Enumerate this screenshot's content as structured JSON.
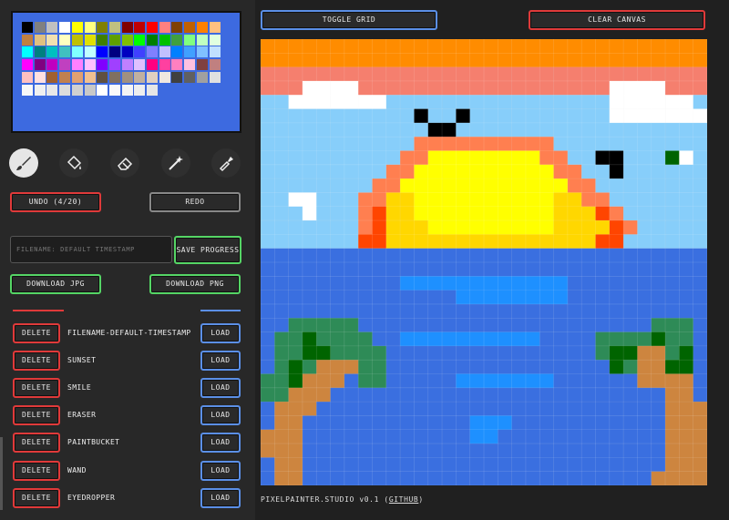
{
  "header": {
    "toggle_grid": "TOGGLE GRID",
    "clear_canvas": "CLEAR CANVAS"
  },
  "tools": [
    {
      "name": "brush-icon",
      "active": true
    },
    {
      "name": "paintbucket-icon",
      "active": false
    },
    {
      "name": "eraser-icon",
      "active": false
    },
    {
      "name": "wand-icon",
      "active": false
    },
    {
      "name": "eyedropper-icon",
      "active": false
    }
  ],
  "actions": {
    "undo": "UNDO (4/20)",
    "redo": "REDO",
    "filename_placeholder": "FILENAME: DEFAULT TIMESTAMP",
    "save": "SAVE PROGRESS",
    "download_jpg": "DOWNLOAD JPG",
    "download_png": "DOWNLOAD PNG"
  },
  "saves": {
    "delete_label": "DELETE",
    "load_label": "LOAD",
    "items": [
      "FILENAME-DEFAULT-TIMESTAMP",
      "SUNSET",
      "SMILE",
      "ERASER",
      "PAINTBUCKET",
      "WAND",
      "EYEDROPPER"
    ]
  },
  "footer": {
    "app": "PIXELPAINTER.STUDIO v0.1",
    "link": "GITHUB"
  },
  "palette": [
    "#000000",
    "#808080",
    "#c0c0c0",
    "#ffffff",
    "#ffff00",
    "#ffff80",
    "#808000",
    "#c0c080",
    "#800000",
    "#c00000",
    "#ff0000",
    "#ff8080",
    "#804000",
    "#c06000",
    "#ff8000",
    "#ffc080",
    "#c08040",
    "#e0c080",
    "#f0e0b0",
    "#ffffc0",
    "#c0c000",
    "#e0e000",
    "#408000",
    "#60a000",
    "#80c000",
    "#00ff00",
    "#008000",
    "#00c000",
    "#40a040",
    "#80ff80",
    "#c0ffc0",
    "#e0ffe0",
    "#00ffff",
    "#008080",
    "#00c0c0",
    "#40c0c0",
    "#80ffff",
    "#c0ffff",
    "#0000ff",
    "#000080",
    "#0000c0",
    "#4040ff",
    "#8080ff",
    "#c0c0ff",
    "#0080ff",
    "#40a0ff",
    "#80c0ff",
    "#c0e0ff",
    "#ff00ff",
    "#800080",
    "#c000c0",
    "#c040c0",
    "#ff80ff",
    "#ffc0ff",
    "#8000ff",
    "#a040ff",
    "#c080ff",
    "#e0c0ff",
    "#ff0080",
    "#ff40a0",
    "#ff80c0",
    "#ffc0e0",
    "#804040",
    "#c08080",
    "#ffc0c0",
    "#ffe0e0",
    "#a06030",
    "#c08050",
    "#e0a070",
    "#f0c090",
    "#605040",
    "#807060",
    "#a09080",
    "#c0b0a0",
    "#e0d0c0",
    "#f0e8e0",
    "#404040",
    "#606060",
    "#a0a0a0",
    "#e0e0e0",
    "#f8f8f8",
    "#f0f0f0",
    "#e8e8e8",
    "#dcdcdc",
    "#d0d0d0",
    "#c8c8c8",
    "#ffffff",
    "#fafafa",
    "#f4f4f4",
    "#eeeeee",
    "#e6e6e6"
  ],
  "canvas": {
    "size": 32,
    "colors": {
      "s": "#87cefa",
      "o": "#ff8c00",
      "p": "#f57f6e",
      "w": "#ffffff",
      "b": "#000000",
      "y": "#ffff00",
      "g": "#ffd700",
      "r": "#ff7f50",
      "q": "#ff4500",
      "d": "#3a6fe0",
      "l": "#1e90ff",
      "t": "#2e8b57",
      "u": "#006400",
      "n": "#cd853f"
    },
    "rows": [
      "oooooooooooooooooooooooooooooooo",
      "oooooooooooooooooooooooooooooooo",
      "pppppppppppppppppppppppppppppppp",
      "pppwwwwppppppppppppppppppwwwwppp",
      "sswwwwwwwsssssssssssssssswwwwwws",
      "sssssssssssbssbsssssssssswwwwwww",
      "ssssssssssssbbssssssssssssssssss",
      "sssssssssssrrrrrrrrrrsssssssssss",
      "ssssssssssrryyyyyyyyrrssbbsssuws",
      "sssssssssrryyyyyyyyyyrrssbssssss",
      "ssssssssrryyyyyyyyyyyyrrssssssss",
      "sswwsssrrggyyyyyyyyyyggrrsssssss",
      "ssswsssrqggyyyyyyyyyygggqrssssss",
      "sssssssrqgggyyyyyyyyyggggqrsssss",
      "sssssssqqgggggggggggggggqqssssss",
      "ddddddddddddddddddddddddddddddddd",
      "ddddddddddddddddddddddddddddddddd",
      "ddddddddddllllllllllllddddddddddd",
      "ddddddddddddddlllllllldddddddddd",
      "dddddddddddddddddddddddddddddddd",
      "ddtttttdddddddddddddddddddddtttd",
      "dttuttttddllllllllllddddttttuttd",
      "dttuuttttdddddddddddddddtuunntud",
      "dtutnnnttddddddddddddddddutnnuud",
      "ttunnndttdddddlllllllddddddnnnnd",
      "ttnnnddddddddddddddddddddddddnnd",
      "dnnndddddddddddddddddddddddddnnn",
      "dnnddddddddddddllldddddddddddnnn",
      "nnnddddddddddddllddddddddddddnnn",
      "nnnddddddddddddddddddddddddddnnn",
      "dnnddddddddddddddddddddddddddnnn",
      "dnndddddddddddddddddddddddddnnnn"
    ]
  }
}
